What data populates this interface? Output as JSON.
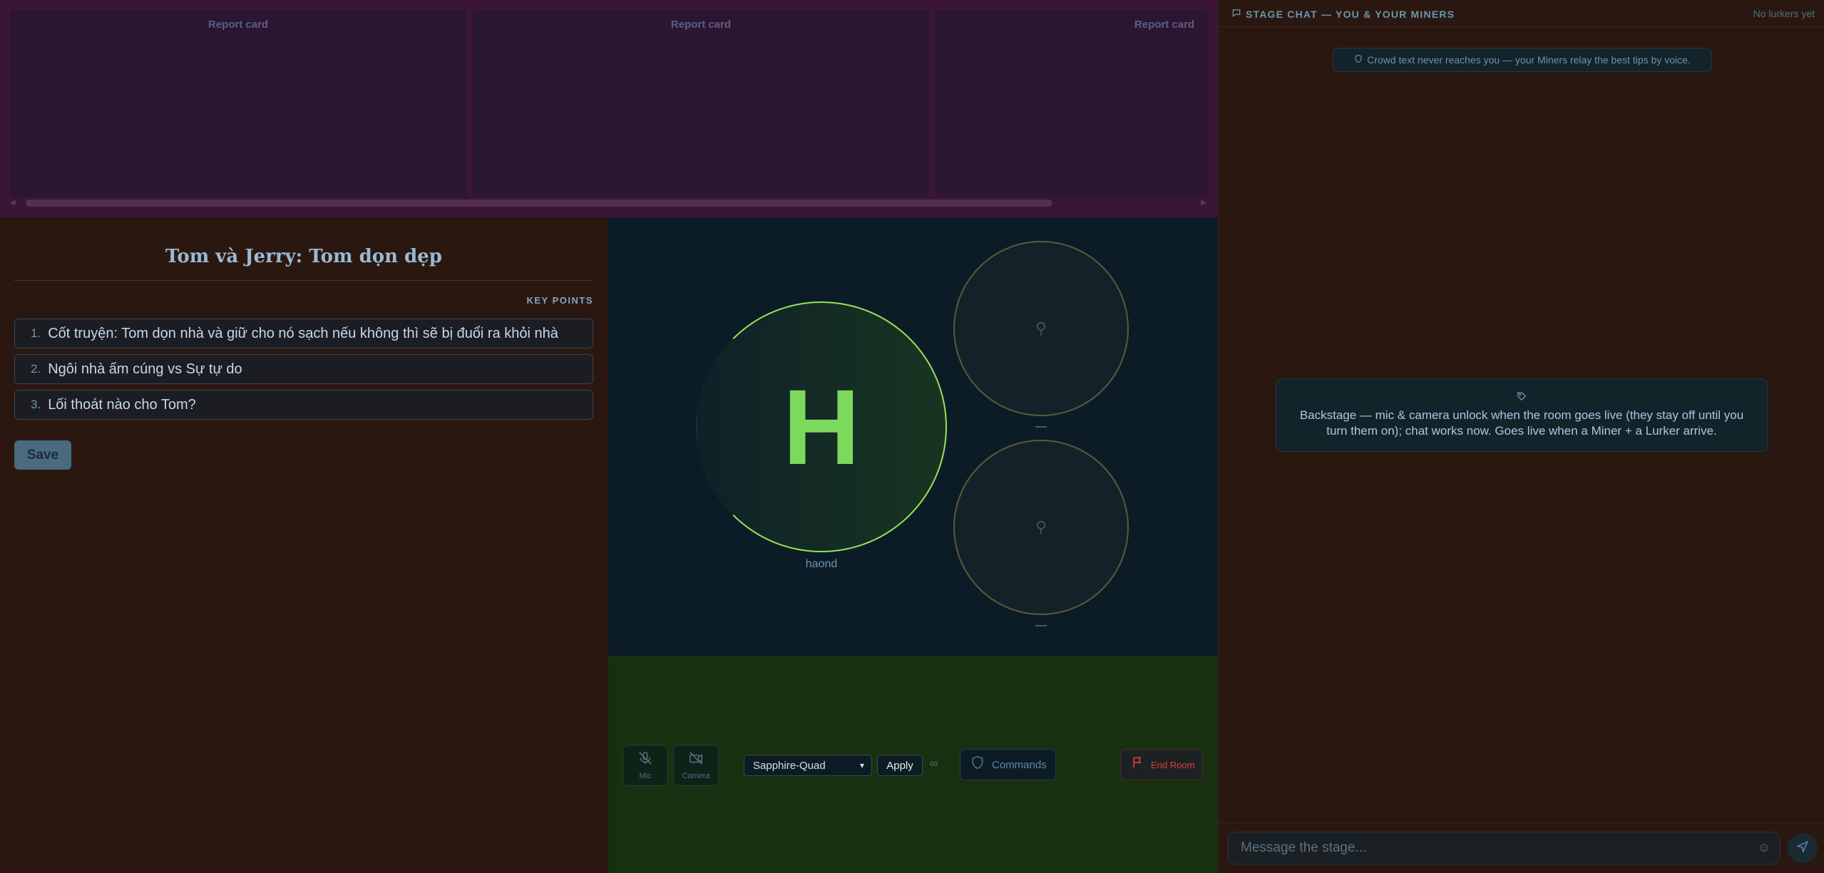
{
  "report_strip": {
    "cards": [
      "Report card",
      "Report card",
      "Report card"
    ],
    "scroll_left": "◀",
    "scroll_right": "▶"
  },
  "notes": {
    "title": "Tom và Jerry: Tom dọn dẹp",
    "key_points_heading": "KEY POINTS",
    "key_points": [
      {
        "num": "1.",
        "text": "Cốt truyện: Tom dọn nhà và giữ cho nó sạch nếu không thì sẽ bị đuổi ra khỏi nhà"
      },
      {
        "num": "2.",
        "text": "Ngôi nhà ấm cúng vs Sự tự do"
      },
      {
        "num": "3.",
        "text": "Lối thoát nào cho Tom?"
      }
    ],
    "save_label": "Save"
  },
  "stage": {
    "host": {
      "initial": "H",
      "name": "haond"
    },
    "slots": [
      {
        "label": "—",
        "icon": "link-icon"
      },
      {
        "label": "—",
        "icon": "link-icon"
      }
    ]
  },
  "controls": {
    "mic_label": "Mic",
    "camera_label": "Camera",
    "layout_value": "Sapphire-Quad",
    "apply_label": "Apply",
    "infinity": "∞",
    "commands_label": "Commands",
    "end_room_label": "End Room"
  },
  "chat": {
    "title": "STAGE CHAT — YOU & YOUR MINERS",
    "lurker_status": "No lurkers yet",
    "crowd_notice": "Crowd text never reaches you — your Miners relay the best tips by voice.",
    "backstage_notice": "Backstage — mic & camera unlock when the room goes live (they stay off until you turn them on); chat works now. Goes live when a Miner + a Lurker arrive.",
    "input_placeholder": "Message the stage..."
  },
  "colors": {
    "accent_green": "#97e25a",
    "host_letter": "#7cd95c",
    "end_room_red": "#e23a3a",
    "stage_bg": "#0c1c26",
    "controls_bg": "#17300f",
    "report_strip_bg": "#3a1535"
  }
}
